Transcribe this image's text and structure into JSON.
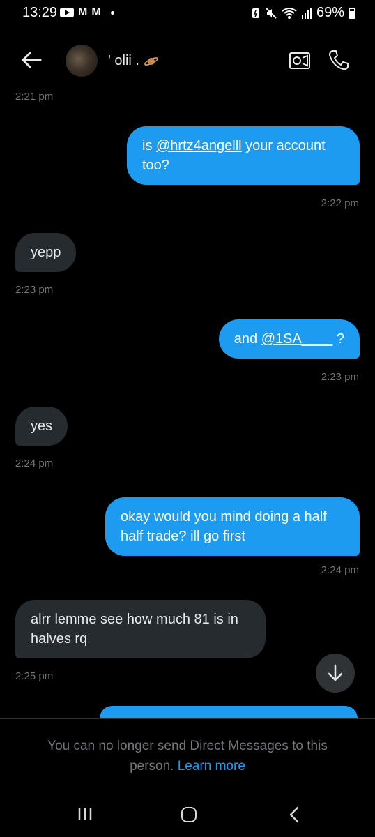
{
  "status_bar": {
    "time": "13:29",
    "battery": "69%"
  },
  "header": {
    "contact_name": "' olii .",
    "icons": [
      "back-arrow-icon",
      "planet-icon",
      "video-icon",
      "phone-icon"
    ]
  },
  "messages": [
    {
      "direction": "in",
      "timestamp": "2:21 pm"
    },
    {
      "direction": "out",
      "text_before": "is ",
      "mention": "@hrtz4angelll",
      "text_after": " your account",
      "line2": "too?",
      "timestamp": "2:22 pm"
    },
    {
      "direction": "in",
      "text": "yepp",
      "timestamp": "2:23 pm"
    },
    {
      "direction": "out",
      "text_before": "and ",
      "mention": "@1SA____",
      "text_after": " ?",
      "timestamp": "2:23 pm"
    },
    {
      "direction": "in",
      "text": "yes",
      "timestamp": "2:24 pm"
    },
    {
      "direction": "out",
      "line1": "okay would you mind doing a half",
      "line2": "half trade? ill go first",
      "timestamp": "2:24 pm"
    },
    {
      "direction": "in",
      "line1": "alrr lemme see how much 81 is in",
      "line2": "halves rq",
      "timestamp": "2:25 pm"
    }
  ],
  "footer": {
    "notice_line1": "You can no longer send Direct Messages to this",
    "notice_line2": "person.",
    "learn_more": "Learn more"
  },
  "colors": {
    "background": "#000000",
    "outgoing_bubble": "#1d9bf0",
    "incoming_bubble": "#262b30",
    "timestamp": "#71767b",
    "link": "#1d9bf0"
  }
}
